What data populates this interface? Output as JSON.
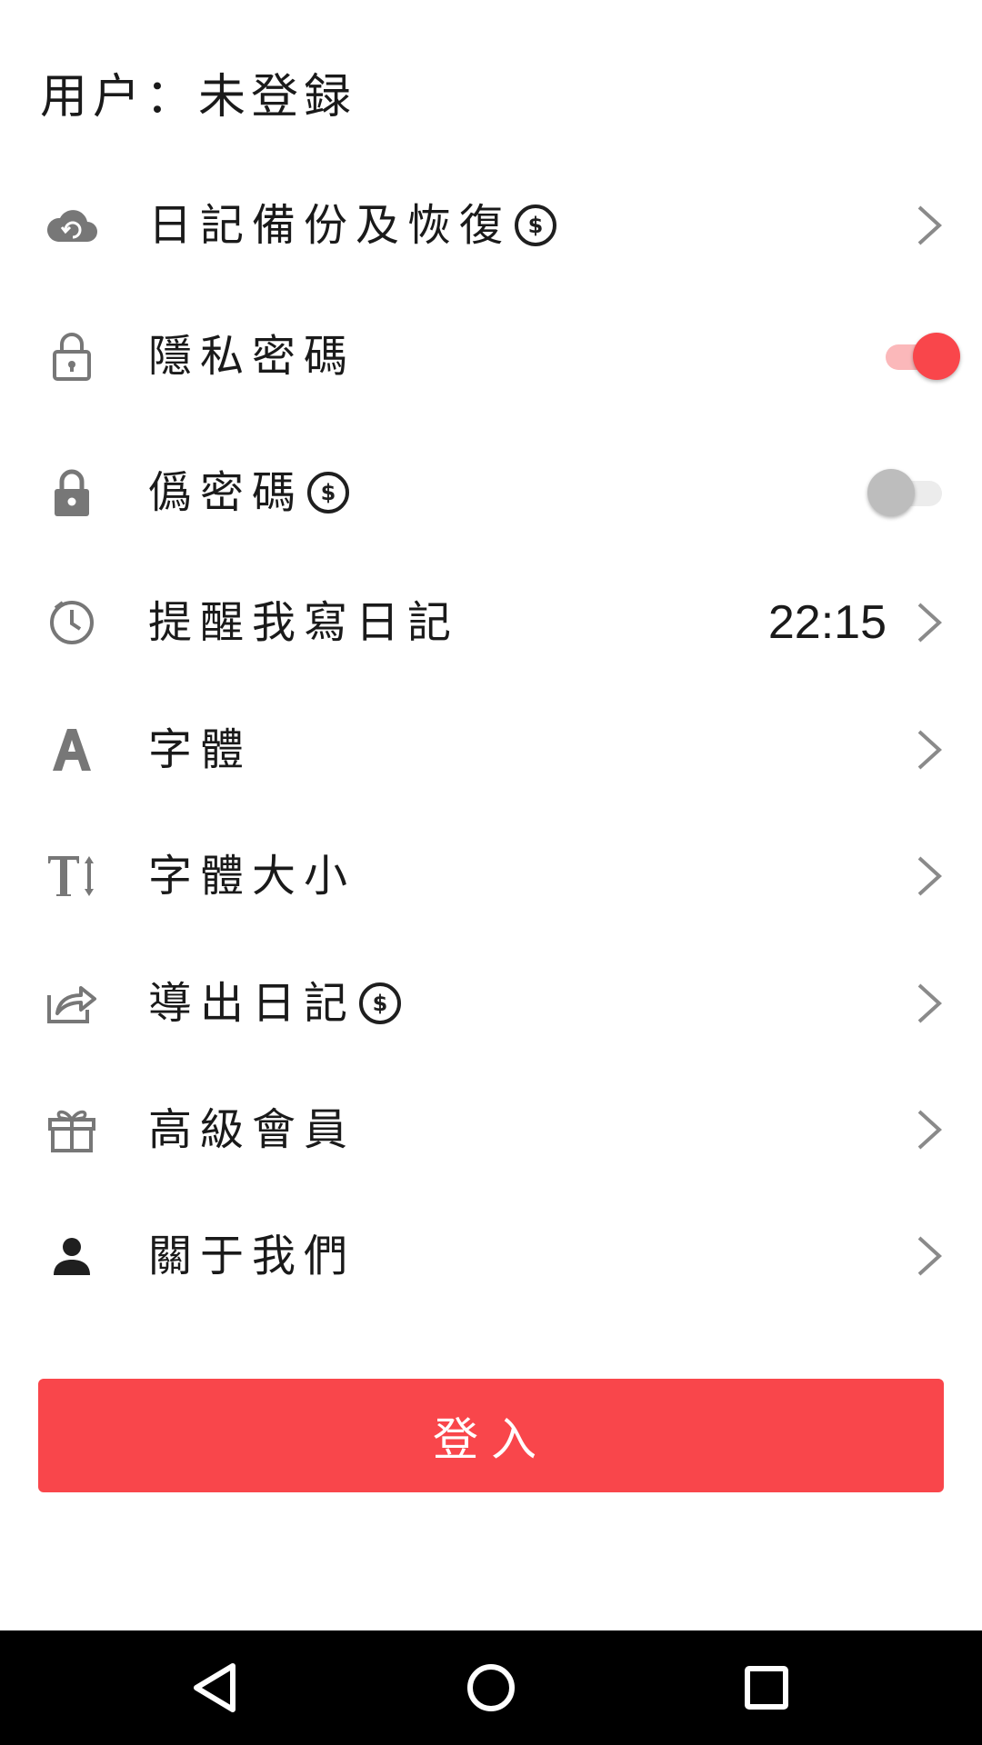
{
  "header": {
    "user_label": "用户：未登録"
  },
  "settings": [
    {
      "id": "backup",
      "label": "日記備份及恢復",
      "icon": "cloud-sync-icon",
      "premium": true,
      "control": "chevron"
    },
    {
      "id": "privacy-password",
      "label": "隱私密碼",
      "icon": "lock-outline-icon",
      "premium": false,
      "control": "toggle",
      "toggle_on": true
    },
    {
      "id": "fake-password",
      "label": "僞密碼",
      "icon": "lock-filled-icon",
      "premium": true,
      "control": "toggle",
      "toggle_on": false
    },
    {
      "id": "reminder",
      "label": "提醒我寫日記",
      "icon": "clock-icon",
      "premium": false,
      "control": "chevron",
      "value": "22:15"
    },
    {
      "id": "font",
      "label": "字體",
      "icon": "font-icon",
      "premium": false,
      "control": "chevron"
    },
    {
      "id": "font-size",
      "label": "字體大小",
      "icon": "text-size-icon",
      "premium": false,
      "control": "chevron"
    },
    {
      "id": "export",
      "label": "導出日記",
      "icon": "share-icon",
      "premium": true,
      "control": "chevron"
    },
    {
      "id": "vip",
      "label": "高級會員",
      "icon": "gift-icon",
      "premium": false,
      "control": "chevron"
    },
    {
      "id": "about",
      "label": "關于我們",
      "icon": "person-icon",
      "premium": false,
      "control": "chevron"
    }
  ],
  "premium_badge": "$",
  "login_button": {
    "label": "登入"
  },
  "colors": {
    "accent": "#f9464b",
    "icon_gray": "#777777",
    "text": "#1a1a1a"
  },
  "nav": [
    "back-icon",
    "home-icon",
    "recents-icon"
  ]
}
